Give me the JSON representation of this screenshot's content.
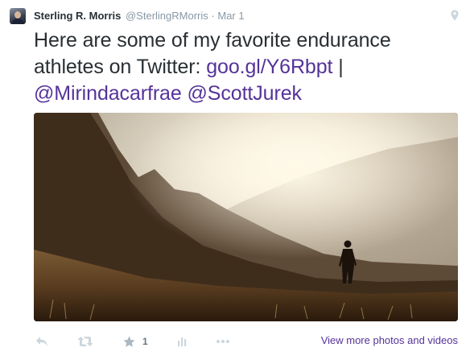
{
  "tweet": {
    "author": {
      "name": "Sterling R. Morris",
      "handle": "@SterlingRMorris"
    },
    "separator": "·",
    "timestamp": "Mar 1",
    "text": {
      "part1": "Here are some of my favorite endurance athletes on Twitter: ",
      "link": "goo.gl/Y6Rbpt",
      "separator": " | ",
      "mention1": "@Mirindacarfrae",
      "mention2": "@ScottJurek"
    },
    "favorite_count": "1",
    "view_more_label": "View more photos and videos"
  },
  "icons": {
    "location": "location-pin-icon",
    "reply": "reply-icon",
    "retweet": "retweet-icon",
    "favorite": "star-icon",
    "analytics": "analytics-bar-icon",
    "more": "ellipsis-icon"
  },
  "colors": {
    "link": "#55339a",
    "text": "#292f33",
    "muted": "#8899a6",
    "action_icon": "#ccd6dd",
    "favorite_icon": "#aab8c2"
  }
}
